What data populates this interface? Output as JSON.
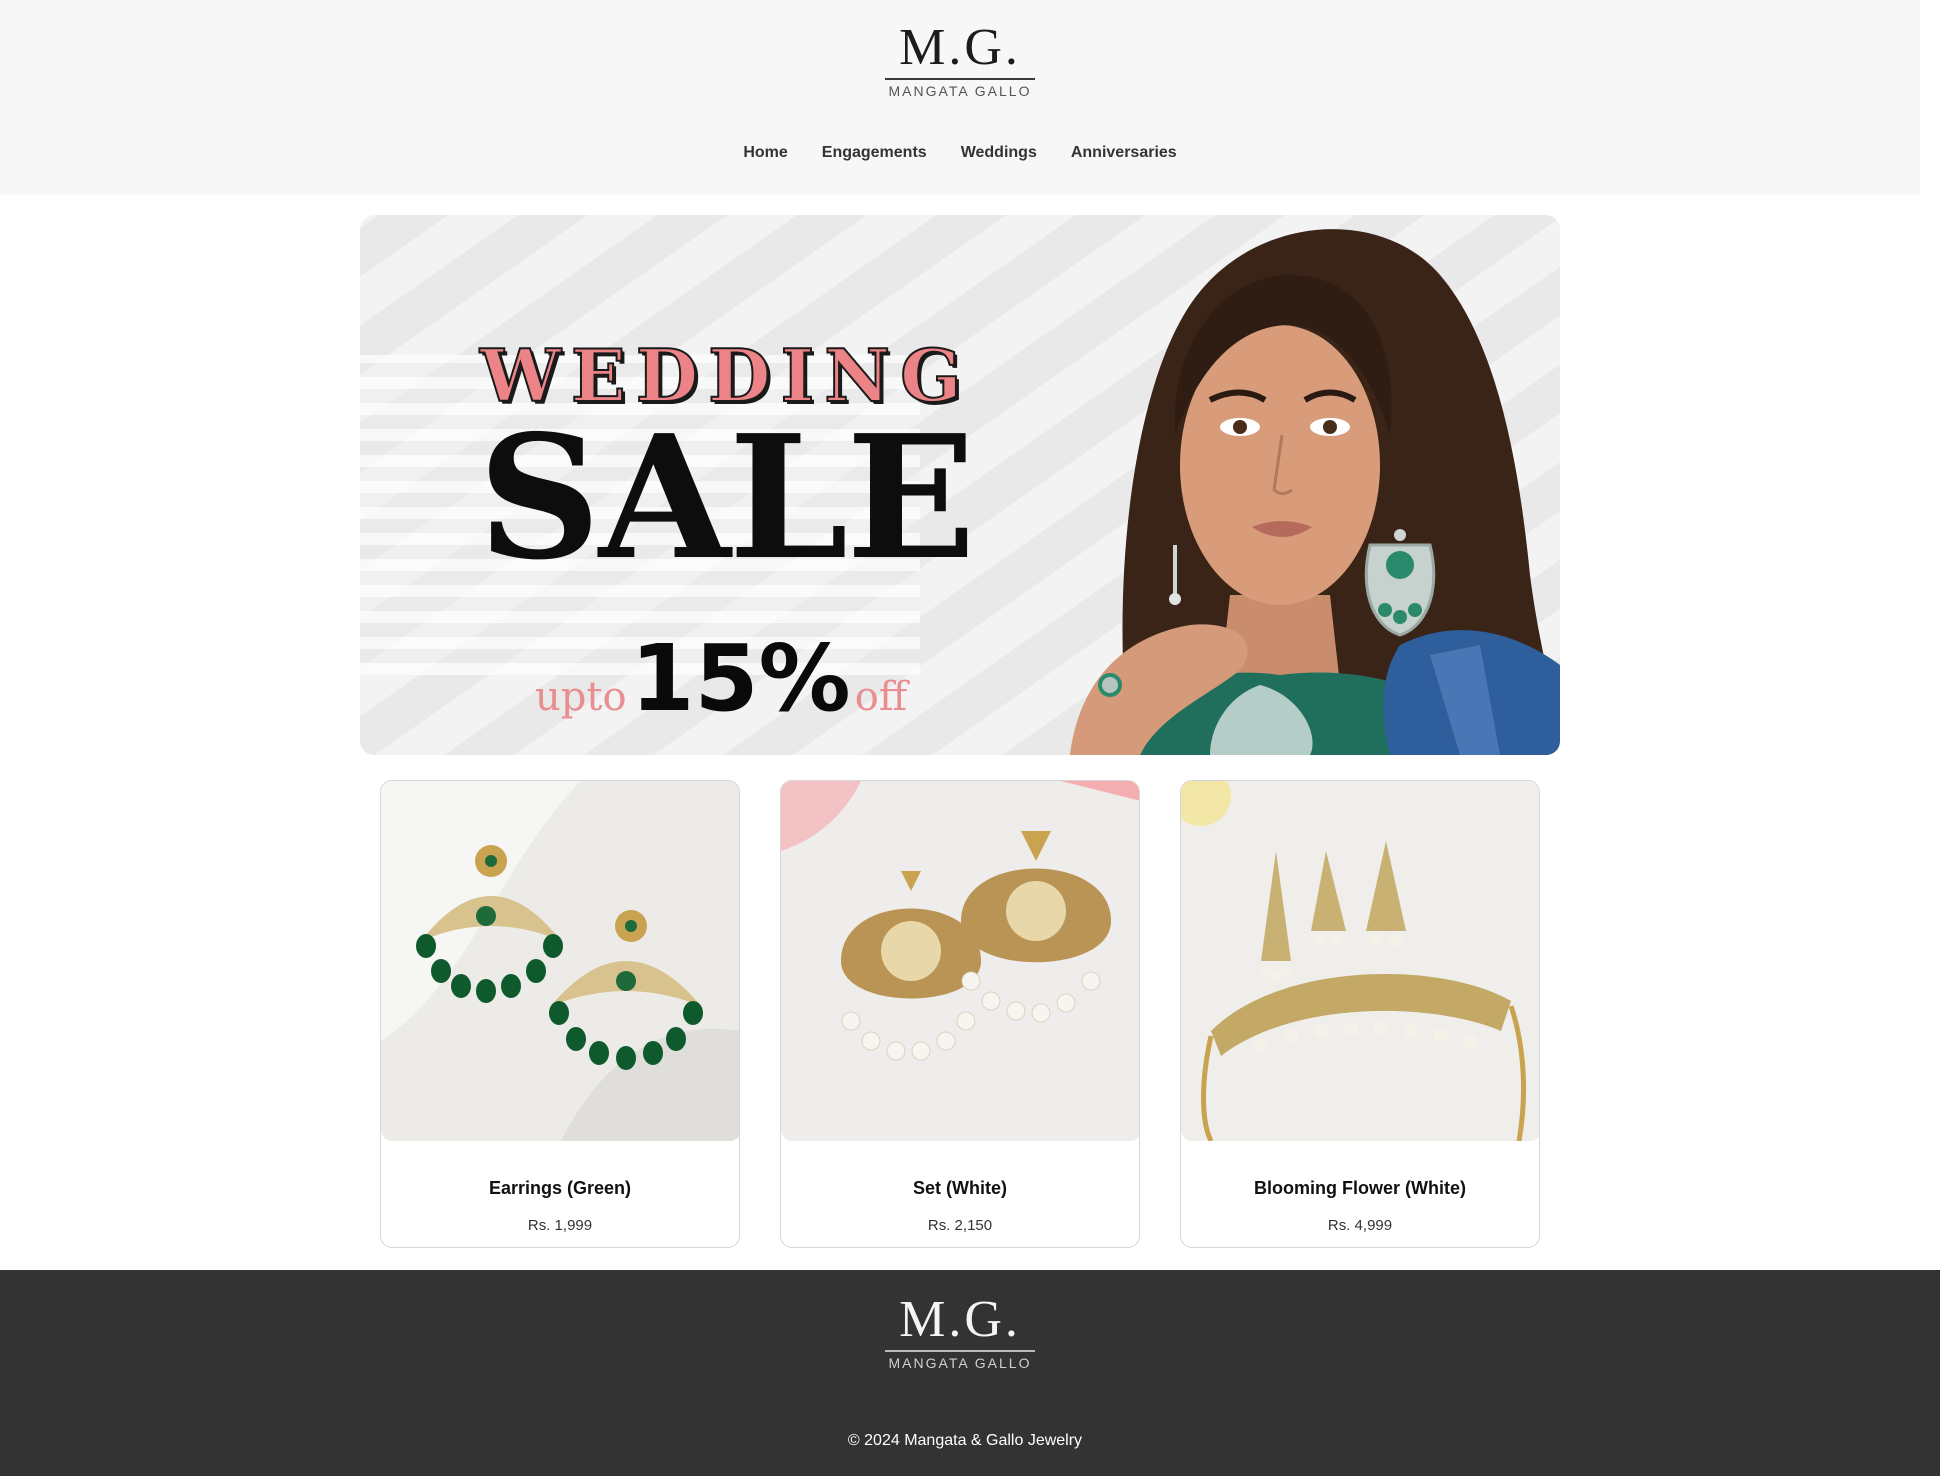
{
  "brand": {
    "monogram": "M.G.",
    "name": "MANGATA GALLO"
  },
  "nav": {
    "items": [
      {
        "label": "Home"
      },
      {
        "label": "Engagements"
      },
      {
        "label": "Weddings"
      },
      {
        "label": "Anniversaries"
      }
    ]
  },
  "hero": {
    "line1": "WEDDING",
    "line2": "SALE",
    "upto": "upto",
    "percent": "15%",
    "off": "off"
  },
  "products": [
    {
      "name": "Earrings (Green)",
      "price": "Rs. 1,999"
    },
    {
      "name": "Set (White)",
      "price": "Rs. 2,150"
    },
    {
      "name": "Blooming Flower (White)",
      "price": "Rs. 4,999"
    }
  ],
  "footer": {
    "monogram": "M.G.",
    "name": "MANGATA GALLO",
    "copyright": "© 2024 Mangata & Gallo Jewelry"
  },
  "colors": {
    "header_bg": "#f7f7f7",
    "footer_bg": "#333333",
    "accent_pink": "#ec8386"
  }
}
